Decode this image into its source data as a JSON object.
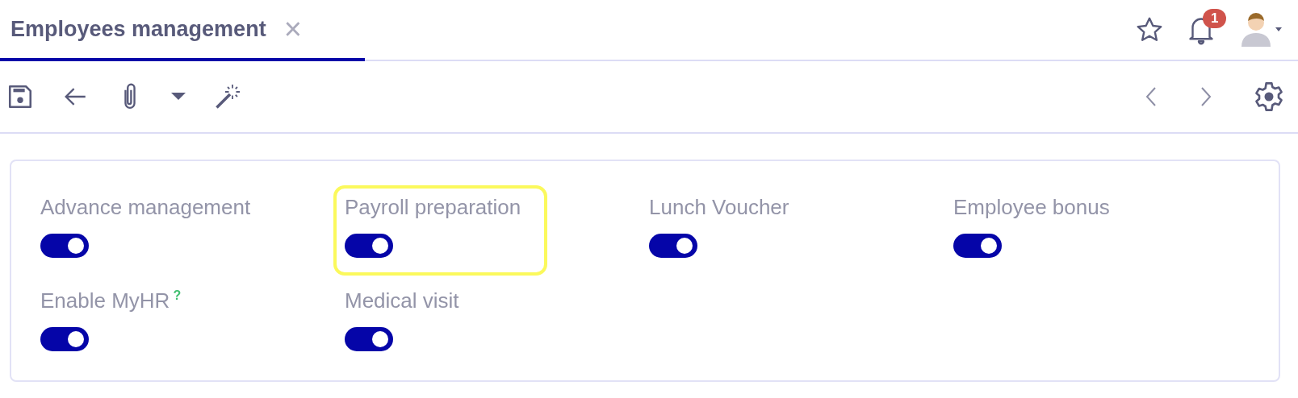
{
  "tab": {
    "title": "Employees management",
    "selected": true,
    "close": "×"
  },
  "notifications": {
    "count": "1"
  },
  "fields": [
    {
      "label": "Advance management",
      "on": true,
      "highlighted": false
    },
    {
      "label": "Payroll preparation",
      "on": true,
      "highlighted": true
    },
    {
      "label": "Lunch Voucher",
      "on": true,
      "highlighted": false
    },
    {
      "label": "Employee bonus",
      "on": true,
      "highlighted": false
    },
    {
      "label": "Enable MyHR",
      "help": "?",
      "on": true,
      "highlighted": false
    },
    {
      "label": "Medical visit",
      "on": true,
      "highlighted": false
    }
  ]
}
